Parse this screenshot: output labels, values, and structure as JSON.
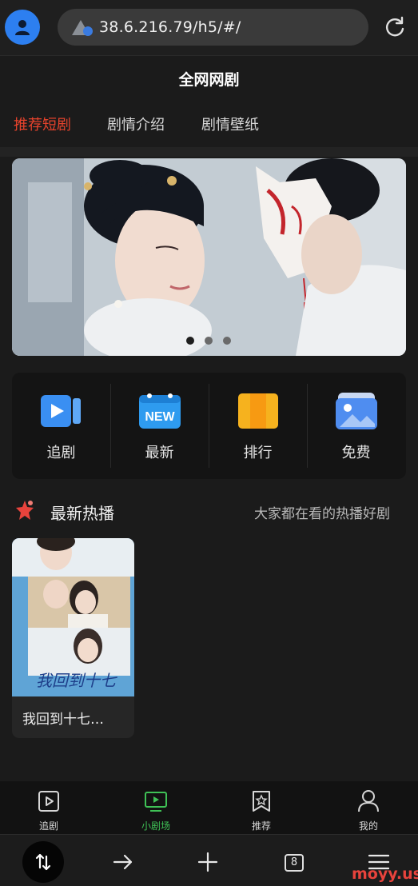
{
  "browser": {
    "url": "38.6.216.79/h5/#/",
    "tab_count": "8",
    "watermark": "moyy.us"
  },
  "app": {
    "title": "全网网剧",
    "top_tabs": [
      {
        "label": "推荐短剧",
        "active": true
      },
      {
        "label": "剧情介绍",
        "active": false
      },
      {
        "label": "剧情壁纸",
        "active": false
      }
    ]
  },
  "banner": {
    "image": "costume-drama-couple-fox-mask",
    "slide_count": 3,
    "active_slide": 1
  },
  "categories": [
    {
      "label": "追剧",
      "icon": "play-video-icon",
      "color": "#3a8ff2"
    },
    {
      "label": "最新",
      "icon": "new-badge-icon",
      "color": "#2e9bef"
    },
    {
      "label": "排行",
      "icon": "ranking-book-icon",
      "color": "#f6b21e"
    },
    {
      "label": "免费",
      "icon": "picture-gallery-icon",
      "color": "#4f8df0"
    }
  ],
  "section": {
    "title": "最新热播",
    "subtitle": "大家都在看的热播好剧"
  },
  "dramas": [
    {
      "title": "我回到十七…",
      "poster": "drama-poster"
    }
  ],
  "app_nav": [
    {
      "label": "追剧",
      "icon": "play-square-icon",
      "active": false
    },
    {
      "label": "小剧场",
      "icon": "tv-screen-icon",
      "active": true
    },
    {
      "label": "推荐",
      "icon": "bookmark-star-icon",
      "active": false
    },
    {
      "label": "我的",
      "icon": "person-icon",
      "active": false
    }
  ],
  "colors": {
    "accent_red": "#e8432c",
    "accent_green": "#3fc156",
    "background": "#1b1b1b"
  }
}
